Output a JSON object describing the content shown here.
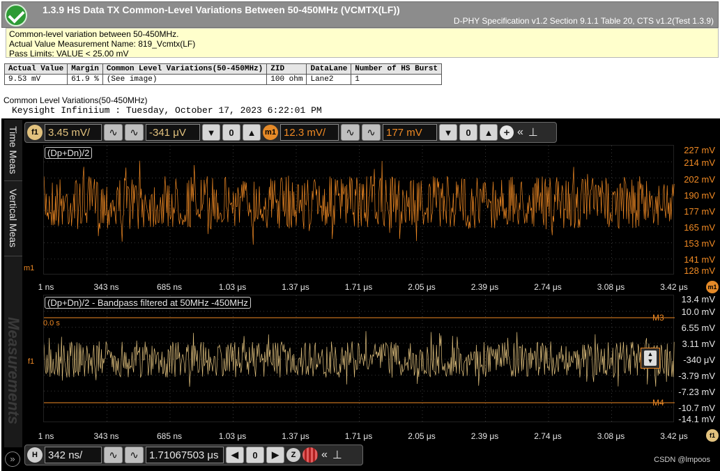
{
  "header": {
    "title": "1.3.9 HS Data TX Common-Level Variations Between 50-450MHz (VCMTX(LF))",
    "spec": "D-PHY Specification v1.2 Section 9.1.1 Table 20, CTS v1.2(Test 1.3.9)"
  },
  "info": {
    "line1": "Common-level variation between 50-450MHz.",
    "line2": "Actual Value Measurement Name: 819_Vcmtx(LF)",
    "line3": "Pass Limits: VALUE < 25.00 mV"
  },
  "results": {
    "headers": [
      "Actual Value",
      "Margin",
      "Common Level Variations(50-450MHz)",
      "ZID",
      "DataLane",
      "Number of HS Burst"
    ],
    "row": [
      "9.53 mV",
      "61.9 %",
      "(See image)",
      "100 ohm",
      "Lane2",
      "1"
    ]
  },
  "caption": "Common Level Variations(50-450MHz)",
  "timestamp": "Keysight Infiniium : Tuesday, October 17, 2023 6:22:01 PM",
  "sidetabs": [
    "Time Meas",
    "Vertical Meas",
    "Measurements"
  ],
  "toolbar_top": {
    "f1_badge": "f1",
    "f1_scale": "3.45 mV/",
    "f1_offset": "-341 μV",
    "m1_badge": "m1",
    "m1_scale": "12.3 mV/",
    "m1_offset": "177 mV"
  },
  "toolbar_bottom": {
    "h_badge": "H",
    "h_scale": "342 ns/",
    "h_delay": "1.71067503 μs",
    "z_badge": "Z"
  },
  "upper_panel": {
    "label": "(Dp+Dn)/2",
    "marker": "m1",
    "y_labels": [
      "227 mV",
      "214 mV",
      "202 mV",
      "190 mV",
      "177 mV",
      "165 mV",
      "153 mV",
      "141 mV",
      "128 mV"
    ],
    "badge": "m1"
  },
  "lower_panel": {
    "label": "(Dp+Dn)/2 - Bandpass filtered at 50MHz -450MHz",
    "trigger_time": "0.0 s",
    "marker": "f1",
    "m3": "M3",
    "m4": "M4",
    "y_labels": [
      "13.4 mV",
      "10.0 mV",
      "6.55 mV",
      "3.11 mV",
      "-340 μV",
      "-3.79 mV",
      "-7.23 mV",
      "-10.7 mV",
      "-14.1 mV"
    ],
    "badge": "f1"
  },
  "x_labels": [
    "1 ns",
    "343 ns",
    "685 ns",
    "1.03 μs",
    "1.37 μs",
    "1.71 μs",
    "2.05 μs",
    "2.39 μs",
    "2.74 μs",
    "3.08 μs",
    "3.42 μs"
  ],
  "watermark": "CSDN @lmpoos",
  "colors": {
    "upper_trace": "#f08a24",
    "lower_trace": "#e2c27e",
    "grid": "#3a3a3a",
    "header_bg": "#8c8c8c",
    "info_bg": "#ffffcc",
    "pass": "#2e9b35"
  }
}
